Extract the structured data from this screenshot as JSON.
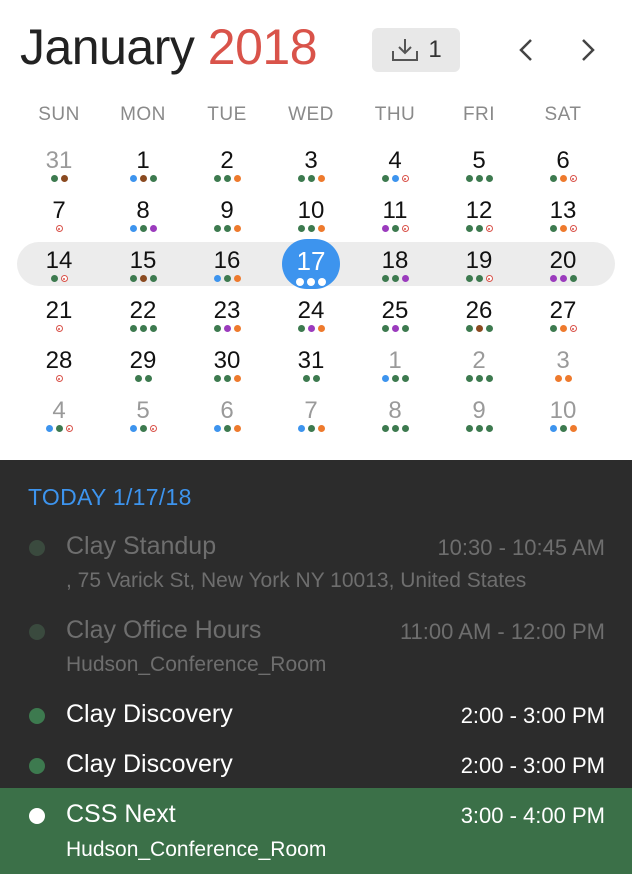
{
  "header": {
    "month": "January",
    "year": "2018",
    "inbox_count": "1"
  },
  "weekdays": [
    "SUN",
    "MON",
    "TUE",
    "WED",
    "THU",
    "FRI",
    "SAT"
  ],
  "weeks": [
    [
      {
        "n": "31",
        "muted": true,
        "dots": [
          "g",
          "br"
        ]
      },
      {
        "n": "1",
        "dots": [
          "b",
          "br",
          "g"
        ]
      },
      {
        "n": "2",
        "dots": [
          "g",
          "g",
          "o"
        ]
      },
      {
        "n": "3",
        "dots": [
          "g",
          "g",
          "o"
        ]
      },
      {
        "n": "4",
        "dots": [
          "g",
          "b",
          "ring"
        ]
      },
      {
        "n": "5",
        "dots": [
          "g",
          "g",
          "g"
        ]
      },
      {
        "n": "6",
        "dots": [
          "g",
          "o",
          "ring"
        ]
      }
    ],
    [
      {
        "n": "7",
        "dots": [
          "ring"
        ]
      },
      {
        "n": "8",
        "dots": [
          "b",
          "g",
          "p"
        ]
      },
      {
        "n": "9",
        "dots": [
          "g",
          "g",
          "o"
        ]
      },
      {
        "n": "10",
        "dots": [
          "g",
          "g",
          "o"
        ]
      },
      {
        "n": "11",
        "dots": [
          "p",
          "g",
          "ring"
        ]
      },
      {
        "n": "12",
        "dots": [
          "g",
          "g",
          "ring"
        ]
      },
      {
        "n": "13",
        "dots": [
          "g",
          "o",
          "ring"
        ]
      }
    ],
    [
      {
        "n": "14",
        "dots": [
          "g",
          "ring"
        ]
      },
      {
        "n": "15",
        "dots": [
          "g",
          "br",
          "g"
        ]
      },
      {
        "n": "16",
        "dots": [
          "b",
          "g",
          "o"
        ]
      },
      {
        "n": "17",
        "today": true,
        "dots": [
          "w",
          "w",
          "w"
        ]
      },
      {
        "n": "18",
        "dots": [
          "g",
          "g",
          "p"
        ]
      },
      {
        "n": "19",
        "dots": [
          "g",
          "g",
          "ring"
        ]
      },
      {
        "n": "20",
        "dots": [
          "p",
          "p",
          "g"
        ]
      }
    ],
    [
      {
        "n": "21",
        "dots": [
          "ring"
        ]
      },
      {
        "n": "22",
        "dots": [
          "g",
          "g",
          "g"
        ]
      },
      {
        "n": "23",
        "dots": [
          "g",
          "p",
          "o"
        ]
      },
      {
        "n": "24",
        "dots": [
          "g",
          "p",
          "o"
        ]
      },
      {
        "n": "25",
        "dots": [
          "g",
          "p",
          "g"
        ]
      },
      {
        "n": "26",
        "dots": [
          "g",
          "br",
          "g"
        ]
      },
      {
        "n": "27",
        "dots": [
          "g",
          "o",
          "ring"
        ]
      }
    ],
    [
      {
        "n": "28",
        "dots": [
          "ring"
        ]
      },
      {
        "n": "29",
        "dots": [
          "g",
          "g"
        ]
      },
      {
        "n": "30",
        "dots": [
          "g",
          "g",
          "o"
        ]
      },
      {
        "n": "31",
        "dots": [
          "g",
          "g"
        ]
      },
      {
        "n": "1",
        "muted": true,
        "dots": [
          "b",
          "g",
          "g"
        ]
      },
      {
        "n": "2",
        "muted": true,
        "dots": [
          "g",
          "g",
          "g"
        ]
      },
      {
        "n": "3",
        "muted": true,
        "dots": [
          "o",
          "o"
        ]
      }
    ],
    [
      {
        "n": "4",
        "muted": true,
        "dots": [
          "b",
          "g",
          "ring"
        ]
      },
      {
        "n": "5",
        "muted": true,
        "dots": [
          "b",
          "g",
          "ring"
        ]
      },
      {
        "n": "6",
        "muted": true,
        "dots": [
          "b",
          "g",
          "o"
        ]
      },
      {
        "n": "7",
        "muted": true,
        "dots": [
          "b",
          "g",
          "o"
        ]
      },
      {
        "n": "8",
        "muted": true,
        "dots": [
          "g",
          "g",
          "g"
        ]
      },
      {
        "n": "9",
        "muted": true,
        "dots": [
          "g",
          "g",
          "g"
        ]
      },
      {
        "n": "10",
        "muted": true,
        "dots": [
          "b",
          "g",
          "o"
        ]
      }
    ]
  ],
  "events_panel": {
    "today_label": "TODAY 1/17/18",
    "events": [
      {
        "name": "Clay Standup",
        "time": "10:30 - 10:45 AM",
        "location": ", 75 Varick St, New York NY 10013, United States",
        "state": "past"
      },
      {
        "name": "Clay Office Hours",
        "time": "11:00 AM - 12:00 PM",
        "location": "Hudson_Conference_Room",
        "state": "past"
      },
      {
        "name": "Clay Discovery",
        "time": "2:00 - 3:00 PM",
        "location": "",
        "state": "upcoming"
      },
      {
        "name": "Clay Discovery",
        "time": "2:00 - 3:00 PM",
        "location": "",
        "state": "upcoming"
      },
      {
        "name": "CSS Next",
        "time": "3:00 - 4:00 PM",
        "location": "Hudson_Conference_Room",
        "state": "active"
      }
    ]
  },
  "colors": {
    "year_red": "#d9534a",
    "today_blue": "#3d94ee",
    "event_green": "#3d7a4f",
    "active_row": "#3b7048"
  }
}
